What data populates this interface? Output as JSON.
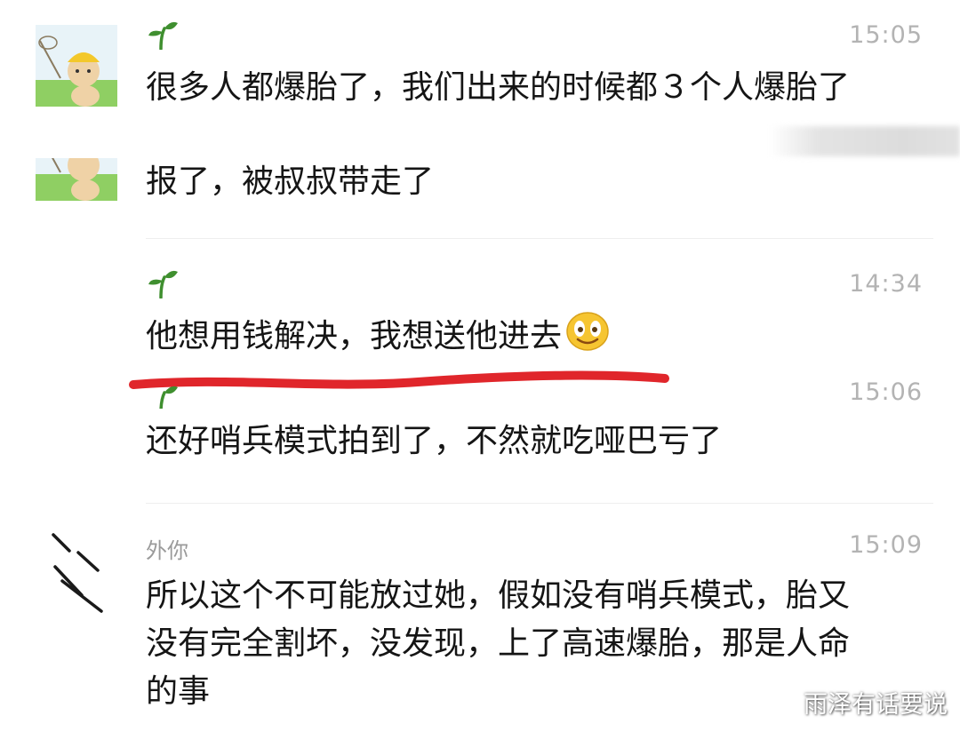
{
  "messages": [
    {
      "sender": "",
      "time": "15:05",
      "text": "很多人都爆胎了，我们出来的时候都３个人爆胎了"
    },
    {
      "sender": "",
      "time": "",
      "text": "报了，被叔叔带走了"
    },
    {
      "sender": "",
      "time": "14:34",
      "text": "他想用钱解决，我想送他进去",
      "emoji": "grinning-face-emoji"
    },
    {
      "sender": "",
      "time": "15:06",
      "text": "还好哨兵模式拍到了，不然就吃哑巴亏了"
    },
    {
      "sender": "外你",
      "time": "15:09",
      "lines": [
        "所以这个不可能放过她，假如没有哨兵模式，胎又",
        "没有完全割坏，没发现，上了高速爆胎，那是人命",
        "的事"
      ]
    }
  ],
  "highlight": {
    "color": "#e0262b"
  },
  "watermark": "雨泽有话要说",
  "colors": {
    "sprout": "#3f8f2f",
    "time": "#b3b3b3",
    "text": "#151515"
  }
}
